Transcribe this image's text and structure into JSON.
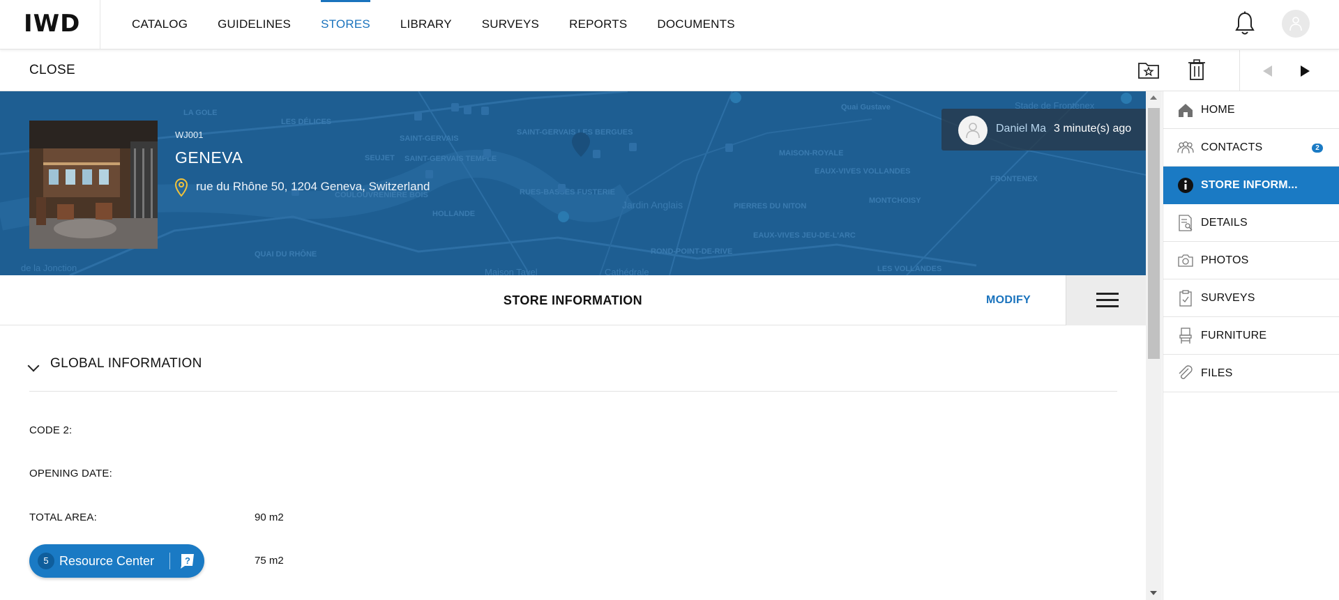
{
  "app": {
    "logo": "IWD"
  },
  "nav": {
    "items": [
      {
        "label": "CATALOG"
      },
      {
        "label": "GUIDELINES"
      },
      {
        "label": "STORES",
        "active": true
      },
      {
        "label": "LIBRARY"
      },
      {
        "label": "SURVEYS"
      },
      {
        "label": "REPORTS"
      },
      {
        "label": "DOCUMENTS"
      }
    ],
    "icons": {
      "notifications": "bell-icon",
      "profile": "user-avatar-icon"
    }
  },
  "toolbar": {
    "close_label": "CLOSE",
    "icons": {
      "favorite": "folder-star-icon",
      "delete": "trash-icon",
      "prev": "triangle-left-icon",
      "next": "triangle-right-icon"
    }
  },
  "store": {
    "code": "WJ001",
    "name": "GENEVA",
    "address": "rue du Rhône 50, 1204 Geneva, Switzerland",
    "pin_icon": "location-pin-icon"
  },
  "map": {
    "labels": [
      "LA GOLE",
      "LES DÉLICES",
      "SAINT-GERVAIS",
      "SAINT-GERVAIS LES BERGUES",
      "SEUJET",
      "SAINT-GERVAIS TEMPLE",
      "COULOUVRENIÈRE BOIS",
      "HOLLANDE",
      "QUAI DU RHÔNE",
      "RUES-BASSES FUSTERIE",
      "Jardin Anglais",
      "PIERRES DU NITON",
      "EAUX-VIVES JEU-DE-L'ARC",
      "MAISON-ROYALE",
      "EAUX-VIVES VOLLANDES",
      "MONTCHOISY",
      "FRONTENEX",
      "ROND-POINT-DE-RIVE",
      "LES VOLLANDES",
      "Stade de Frontenex",
      "Maison Tavel",
      "Cathédrale",
      "de la Jonction",
      "Quai Gustave"
    ]
  },
  "activity": {
    "user": "Daniel Ma",
    "time": "3 minute(s) ago"
  },
  "section": {
    "title": "STORE INFORMATION",
    "modify_label": "MODIFY",
    "menu_icon": "hamburger-menu-icon"
  },
  "global_info": {
    "title": "GLOBAL INFORMATION",
    "fields": [
      {
        "label": "CODE 2:",
        "value": ""
      },
      {
        "label": "OPENING DATE:",
        "value": ""
      },
      {
        "label": "TOTAL AREA:",
        "value": "90 m2"
      },
      {
        "label": "",
        "value": "75 m2"
      }
    ]
  },
  "resource_center": {
    "count": "5",
    "label": "Resource Center",
    "icon": "help-chat-icon"
  },
  "sidebar": {
    "items": [
      {
        "label": "HOME",
        "icon": "home-icon"
      },
      {
        "label": "CONTACTS",
        "icon": "contacts-icon",
        "badge": "2"
      },
      {
        "label": "STORE INFORM...",
        "icon": "info-icon",
        "active": true
      },
      {
        "label": "DETAILS",
        "icon": "details-icon"
      },
      {
        "label": "PHOTOS",
        "icon": "camera-icon"
      },
      {
        "label": "SURVEYS",
        "icon": "clipboard-check-icon"
      },
      {
        "label": "FURNITURE",
        "icon": "chair-icon"
      },
      {
        "label": "FILES",
        "icon": "paperclip-icon"
      }
    ]
  },
  "colors": {
    "accent": "#1a73bd",
    "hero": "#1f5f93",
    "active_sidebar": "#1a7ac4"
  }
}
